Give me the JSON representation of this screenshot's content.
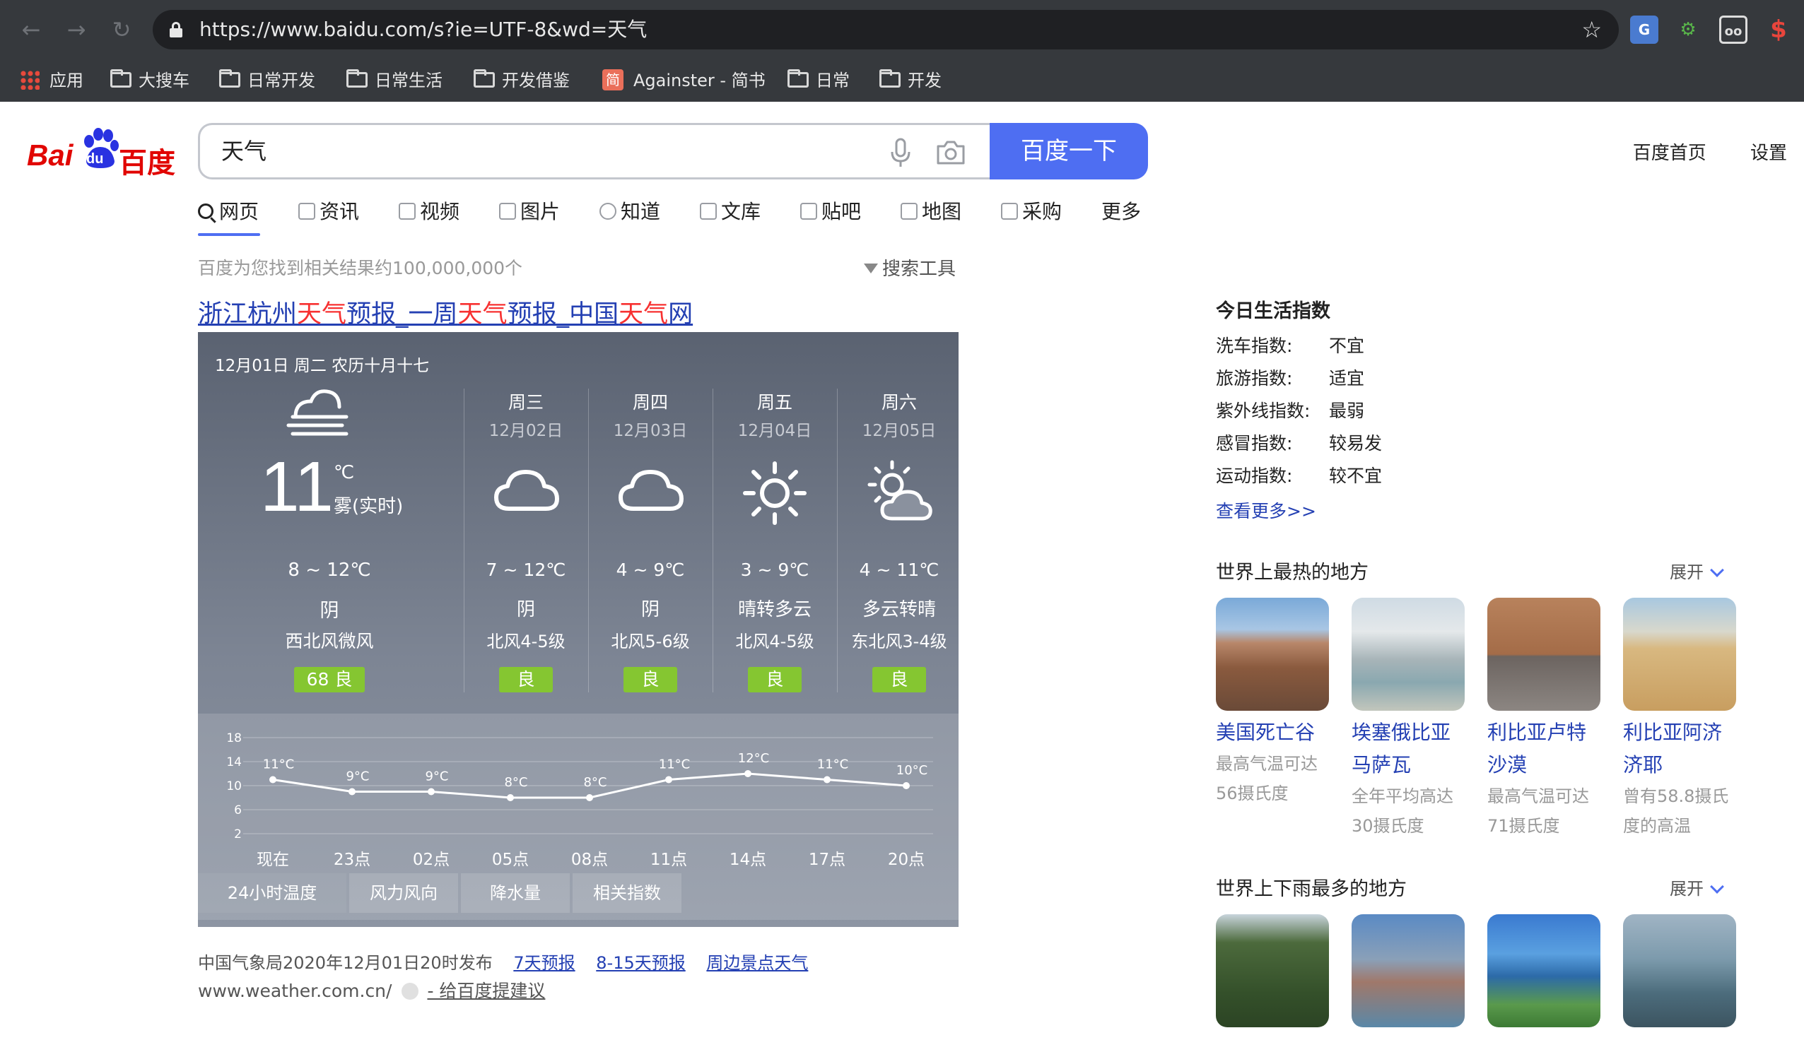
{
  "browser": {
    "url": "https://www.baidu.com/s?ie=UTF-8&wd=天气",
    "bookmarks": [
      "应用",
      "大搜车",
      "日常开发",
      "日常生活",
      "开发借鉴",
      "Againster - 简书",
      "日常",
      "开发"
    ],
    "jianshu_glyph": "简"
  },
  "header": {
    "logo_latin": "Bai",
    "logo_du": "du",
    "logo_cn": "百度",
    "query": "天气",
    "search_button": "百度一下",
    "links": [
      "百度首页",
      "设置"
    ]
  },
  "tabs": [
    "网页",
    "资讯",
    "视频",
    "图片",
    "知道",
    "文库",
    "贴吧",
    "地图",
    "采购",
    "更多"
  ],
  "result_count": "百度为您找到相关结果约100,000,000个",
  "search_tools": "搜索工具",
  "result": {
    "title_parts": [
      "浙江杭州",
      "天气",
      "预报_一周",
      "天气",
      "预报_中国",
      "天气",
      "网"
    ]
  },
  "weather": {
    "date": "12月01日 周二 农历十月十七",
    "today": {
      "temp": "11",
      "unit": "℃",
      "condition": "雾(实时)",
      "range": "8 ~ 12℃",
      "desc": "阴",
      "wind": "西北风微风",
      "aqi": "68  良"
    },
    "days": [
      {
        "name": "周三",
        "date": "12月02日",
        "icon": "cloud-icon",
        "range": "7 ~ 12℃",
        "desc": "阴",
        "wind": "北风4-5级",
        "aqi": "良"
      },
      {
        "name": "周四",
        "date": "12月03日",
        "icon": "cloud-icon",
        "range": "4 ~ 9℃",
        "desc": "阴",
        "wind": "北风5-6级",
        "aqi": "良"
      },
      {
        "name": "周五",
        "date": "12月04日",
        "icon": "sun-icon",
        "range": "3 ~ 9℃",
        "desc": "晴转多云",
        "wind": "北风4-5级",
        "aqi": "良"
      },
      {
        "name": "周六",
        "date": "12月05日",
        "icon": "sun-cloud-icon",
        "range": "4 ~ 11℃",
        "desc": "多云转晴",
        "wind": "东北风3-4级",
        "aqi": "良"
      }
    ],
    "subtabs": [
      "24小时温度",
      "风力风向",
      "降水量",
      "相关指数"
    ]
  },
  "chart_data": {
    "type": "line",
    "title": "",
    "xlabel": "",
    "ylabel": "",
    "categories": [
      "现在",
      "23点",
      "02点",
      "05点",
      "08点",
      "11点",
      "14点",
      "17点",
      "20点"
    ],
    "values": [
      11,
      9,
      9,
      8,
      8,
      11,
      12,
      11,
      10
    ],
    "labels": [
      "11°C",
      "9°C",
      "9°C",
      "8°C",
      "8°C",
      "11°C",
      "12°C",
      "11°C",
      "10°C"
    ],
    "yticks": [
      18,
      14,
      10,
      6,
      2
    ],
    "ylim": [
      2,
      18
    ],
    "grid": true
  },
  "source": {
    "text": "中国气象局2020年12月01日20时发布",
    "links": [
      "7天预报",
      "8-15天预报",
      "周边景点天气"
    ],
    "url": "www.weather.com.cn/",
    "suggest": "- 给百度提建议"
  },
  "right_panel": {
    "index_title": "今日生活指数",
    "indices": [
      {
        "label": "洗车指数:",
        "value": "不宜"
      },
      {
        "label": "旅游指数:",
        "value": "适宜"
      },
      {
        "label": "紫外线指数:",
        "value": "最弱"
      },
      {
        "label": "感冒指数:",
        "value": "较易发"
      },
      {
        "label": "运动指数:",
        "value": "较不宜"
      }
    ],
    "more": "查看更多>>",
    "hottest_title": "世界上最热的地方",
    "expand": "展开",
    "hottest": [
      {
        "name": "美国死亡谷",
        "desc": "最高气温可达56摄氏度"
      },
      {
        "name": "埃塞俄比亚马萨瓦",
        "desc": "全年平均高达30摄氏度"
      },
      {
        "name": "利比亚卢特沙漠",
        "desc": "最高气温可达71摄氏度"
      },
      {
        "name": "利比亚阿济济耶",
        "desc": "曾有58.8摄氏度的高温"
      }
    ],
    "rainiest_title": "世界上下雨最多的地方"
  }
}
